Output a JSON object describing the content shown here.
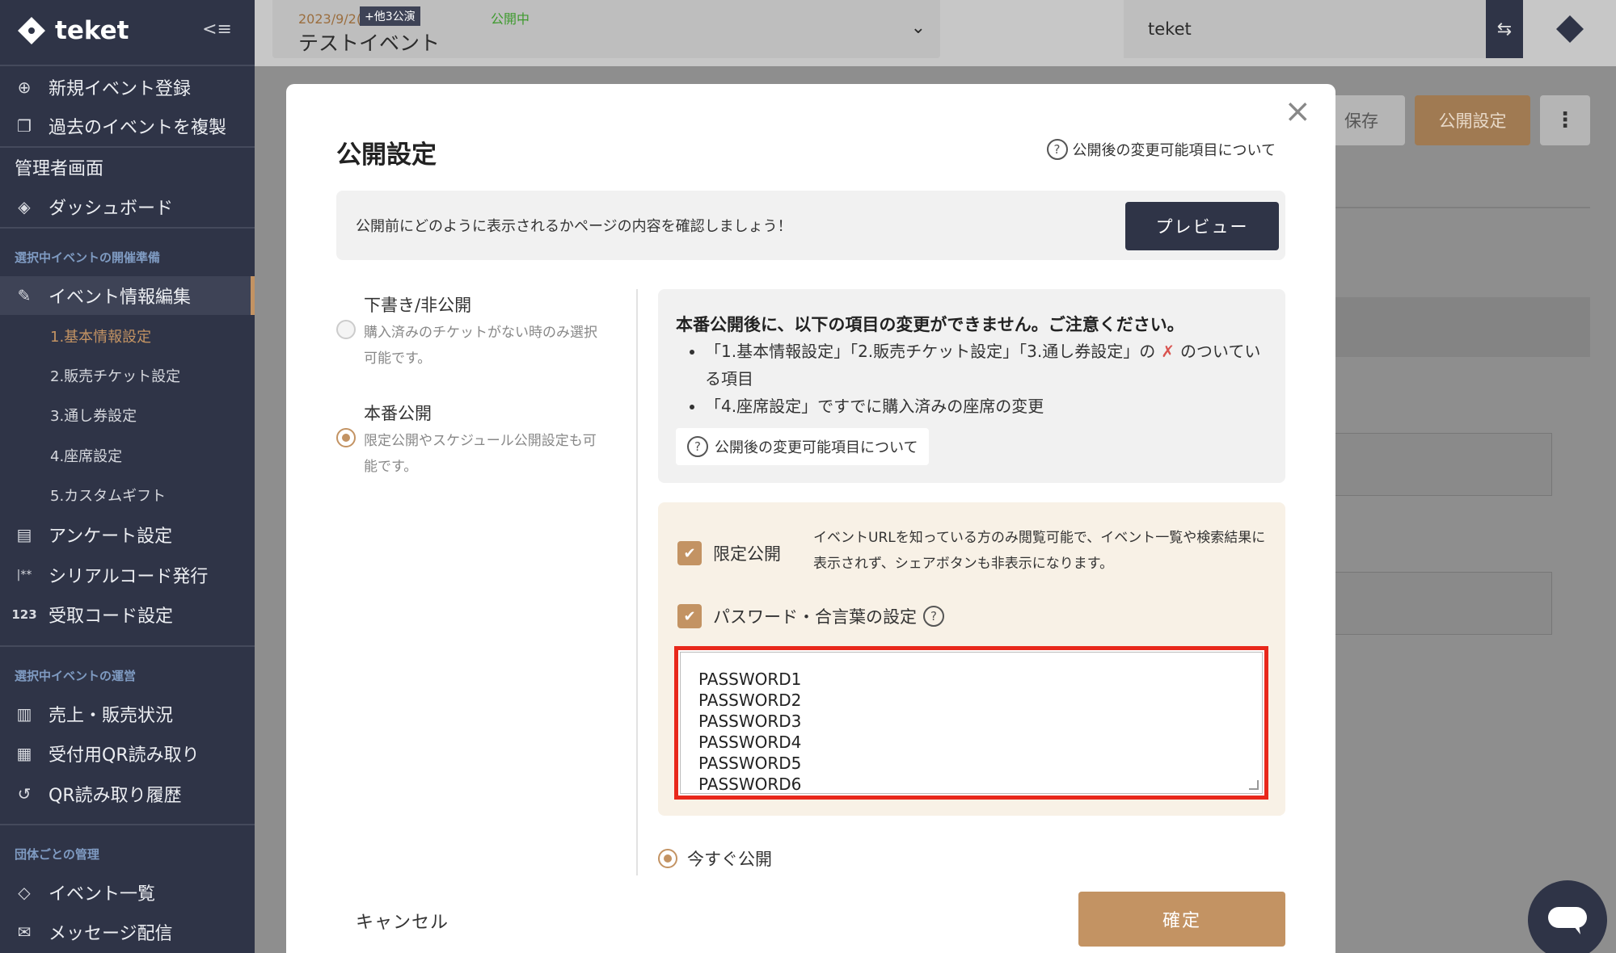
{
  "sidebar": {
    "brand": "teket",
    "items": [
      {
        "label": "新規イベント登録",
        "icon": "plus-circle-icon"
      },
      {
        "label": "過去のイベントを複製",
        "icon": "copy-icon"
      },
      {
        "label": "管理者画面"
      },
      {
        "label": "ダッシュボード",
        "icon": "layers-icon"
      }
    ],
    "section_prep": "選択中イベントの開催準備",
    "prep_items": [
      {
        "label": "イベント情報編集",
        "icon": "edit-icon"
      },
      {
        "label": "1.基本情報設定"
      },
      {
        "label": "2.販売チケット設定"
      },
      {
        "label": "3.通し券設定"
      },
      {
        "label": "4.座席設定"
      },
      {
        "label": "5.カスタムギフト"
      },
      {
        "label": "アンケート設定",
        "icon": "document-icon"
      },
      {
        "label": "シリアルコード発行",
        "icon": "serial-icon",
        "icon_text": "|**"
      },
      {
        "label": "受取コード設定",
        "icon": "number-icon",
        "icon_text": "123"
      }
    ],
    "section_ops": "選択中イベントの運営",
    "ops_items": [
      {
        "label": "売上・販売状況",
        "icon": "bar-chart-icon"
      },
      {
        "label": "受付用QR読み取り",
        "icon": "qr-icon"
      },
      {
        "label": "QR読み取り履歴",
        "icon": "history-icon"
      }
    ],
    "section_org": "団体ごとの管理",
    "org_items": [
      {
        "label": "イベント一覧",
        "icon": "ticket-icon"
      },
      {
        "label": "メッセージ配信",
        "icon": "mail-icon"
      }
    ]
  },
  "topbar": {
    "event_date": "2023/9/2(土)",
    "event_badge": "+他3公演",
    "event_status": "公開中",
    "event_name": "テストイベント",
    "org_name": "teket"
  },
  "page": {
    "save_label": "保存",
    "publish_settings_label": "公開設定"
  },
  "modal": {
    "title": "公開設定",
    "help_link": "公開後の変更可能項目について",
    "preview_text": "公開前にどのように表示されるかページの内容を確認しましょう！",
    "preview_button": "プレビュー",
    "option_draft_title": "下書き/非公開",
    "option_draft_desc": "購入済みのチケットがない時のみ選択可能です。",
    "option_live_title": "本番公開",
    "option_live_desc": "限定公開やスケジュール公開設定も可能です。",
    "warning_title": "本番公開後に、以下の項目の変更ができません。ご注意ください。",
    "warning_item1_a": "「1.基本情報設定」「2.販売チケット設定」「3.通し券設定」の",
    "warning_item1_b": "のついている項目",
    "warning_item2": "「4.座席設定」ですでに購入済みの座席の変更",
    "warning_help": "公開後の変更可能項目について",
    "limited_label": "限定公開",
    "limited_desc": "イベントURLを知っている方のみ閲覧可能で、イベント一覧や検索結果に表示されず、シェアボタンも非表示になります。",
    "password_label": "パスワード・合言葉の設定",
    "passwords": [
      "PASSWORD1",
      "PASSWORD2",
      "PASSWORD3",
      "PASSWORD4",
      "PASSWORD5",
      "PASSWORD6"
    ],
    "publish_now": "今すぐ公開",
    "cancel": "キャンセル",
    "confirm": "確定"
  },
  "colors": {
    "sidebar_bg": "#2f3447",
    "accent": "#c39363",
    "highlight": "#e8281b"
  }
}
